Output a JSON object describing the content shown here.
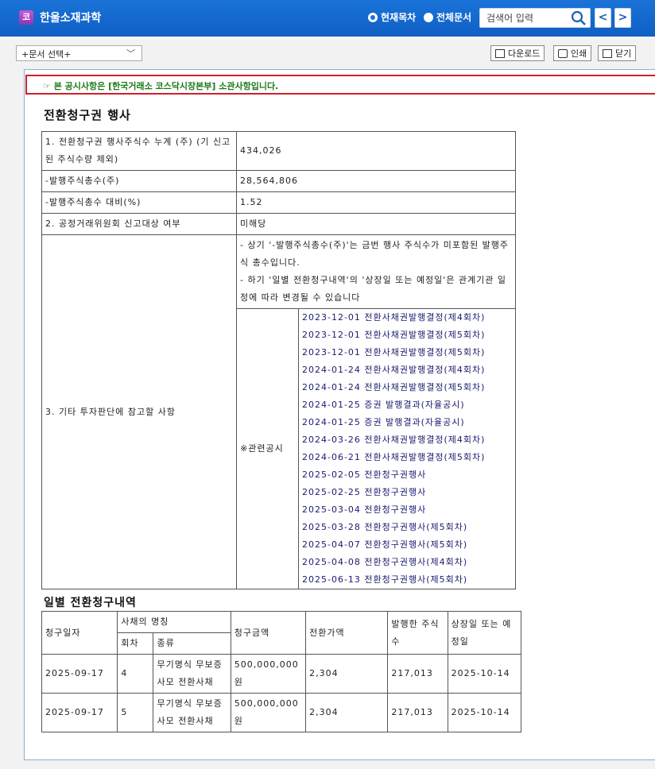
{
  "header": {
    "logo_char": "코",
    "company": "한울소재과학",
    "radio_current": "현재목차",
    "radio_all": "전체문서",
    "search_placeholder": "검색어 입력",
    "prev": "<",
    "next": ">"
  },
  "toolbar": {
    "doc_select": "+문서 선택+",
    "download": "다운로드",
    "print": "인쇄",
    "close": "닫기"
  },
  "notice": "☞ 본 공시사항은 [한국거래소 코스닥시장본부] 소관사항입니다.",
  "title": "전환청구권 행사",
  "summary": {
    "r1_label": "1. 전환청구권 행사주식수 누계 (주) (기 신고된 주식수량 제외)",
    "r1_value": "434,026",
    "r2_label": "-발행주식총수(주)",
    "r2_value": "28,564,806",
    "r3_label": "-발행주식총수 대비(%)",
    "r3_value": "1.52",
    "r4_label": "2. 공정거래위원회 신고대상 여부",
    "r4_value": "미해당",
    "r5_label": "3. 기타 투자판단에 참고할 사항",
    "r5_note": "- 상기 '-발행주식총수(주)'는 금번 행사 주식수가 미포함된 발행주식 총수입니다.\n- 하기 '일별 전환청구내역'의 '상장일 또는 예정일'은 관계기관 일정에 따라 변경될 수 있습니다",
    "related_label": "※관련공시",
    "related": [
      "2023-12-01 전환사채권발행결정(제4회차)",
      "2023-12-01 전환사채권발행결정(제5회차)",
      "2023-12-01 전환사채권발행결정(제5회차)",
      "2024-01-24 전환사채권발행결정(제4회차)",
      "2024-01-24 전환사채권발행결정(제5회차)",
      "2024-01-25 증권 발행결과(자율공시)",
      "2024-01-25 증권 발행결과(자율공시)",
      "2024-03-26 전환사채권발행결정(제4회차)",
      "2024-06-21 전환사채권발행결정(제5회차)",
      "2025-02-05 전환청구권행사",
      "2025-02-25 전환청구권행사",
      "2025-03-04 전환청구권행사",
      "2025-03-28 전환청구권행사(제5회차)",
      "2025-04-07 전환청구권행사(제5회차)",
      "2025-04-08 전환청구권행사(제4회차)",
      "2025-06-13 전환청구권행사(제5회차)"
    ]
  },
  "daily_title": "일별 전환청구내역",
  "daily": {
    "h_date": "청구일자",
    "h_name": "사채의 명칭",
    "h_round": "회차",
    "h_kind": "종류",
    "h_amount": "청구금액",
    "h_price": "전환가액",
    "h_shares": "발행한 주식수",
    "h_list": "상장일 또는 예정일",
    "rows": [
      {
        "date": "2025-09-17",
        "round": "4",
        "kind": "무기명식 무보증 사모 전환사채",
        "amount": "500,000,000원",
        "price": "2,304",
        "shares": "217,013",
        "list": "2025-10-14"
      },
      {
        "date": "2025-09-17",
        "round": "5",
        "kind": "무기명식 무보증 사모 전환사채",
        "amount": "500,000,000원",
        "price": "2,304",
        "shares": "217,013",
        "list": "2025-10-14"
      }
    ]
  }
}
